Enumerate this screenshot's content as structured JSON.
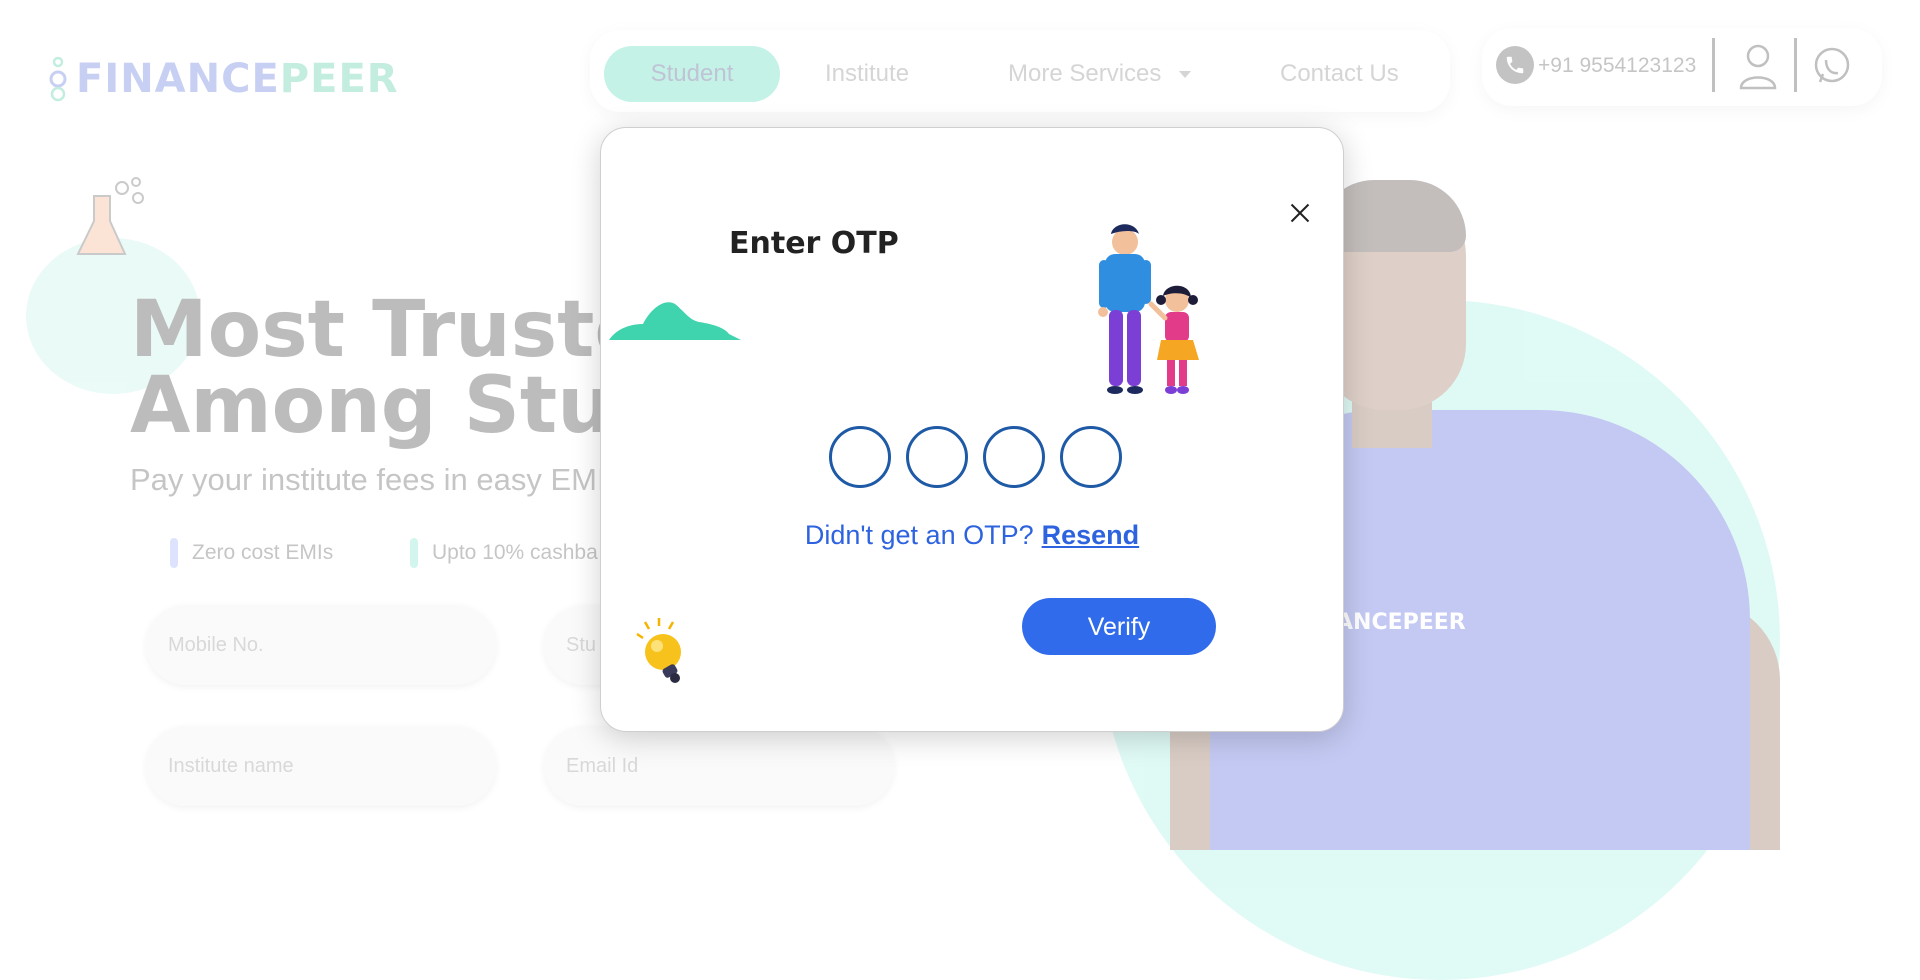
{
  "brand": {
    "logo_part1": "FINANCE",
    "logo_part2": "PEER",
    "primary_color": "#3b57d6",
    "accent_color": "#27c08f"
  },
  "nav": {
    "items": [
      {
        "label": "Student",
        "active": true
      },
      {
        "label": "Institute",
        "active": false
      },
      {
        "label": "More Services",
        "active": false
      },
      {
        "label": "Contact Us",
        "active": false
      }
    ]
  },
  "contact": {
    "phone": "+91 9554123123",
    "icons": [
      "phone-icon",
      "user-icon",
      "whatsapp-icon"
    ]
  },
  "hero": {
    "title_line1": "Most Trusted",
    "title_line2": "Among Stude",
    "subtitle": "Pay your institute fees in easy EMIs",
    "features": [
      "Zero cost EMIs",
      "Upto 10% cashba"
    ],
    "shirt_text": "ANCEPEER"
  },
  "form": {
    "mobile_placeholder": "Mobile No.",
    "student_placeholder": "Stu",
    "institute_placeholder": "Institute name",
    "email_placeholder": "Email Id"
  },
  "modal": {
    "title": "Enter OTP",
    "otp_digits": [
      "",
      "",
      "",
      ""
    ],
    "resend_prompt": "Didn't get an OTP?",
    "resend_link": "Resend",
    "verify_label": "Verify",
    "button_color": "#2f6bea",
    "otp_border_color": "#1f5aa6"
  }
}
